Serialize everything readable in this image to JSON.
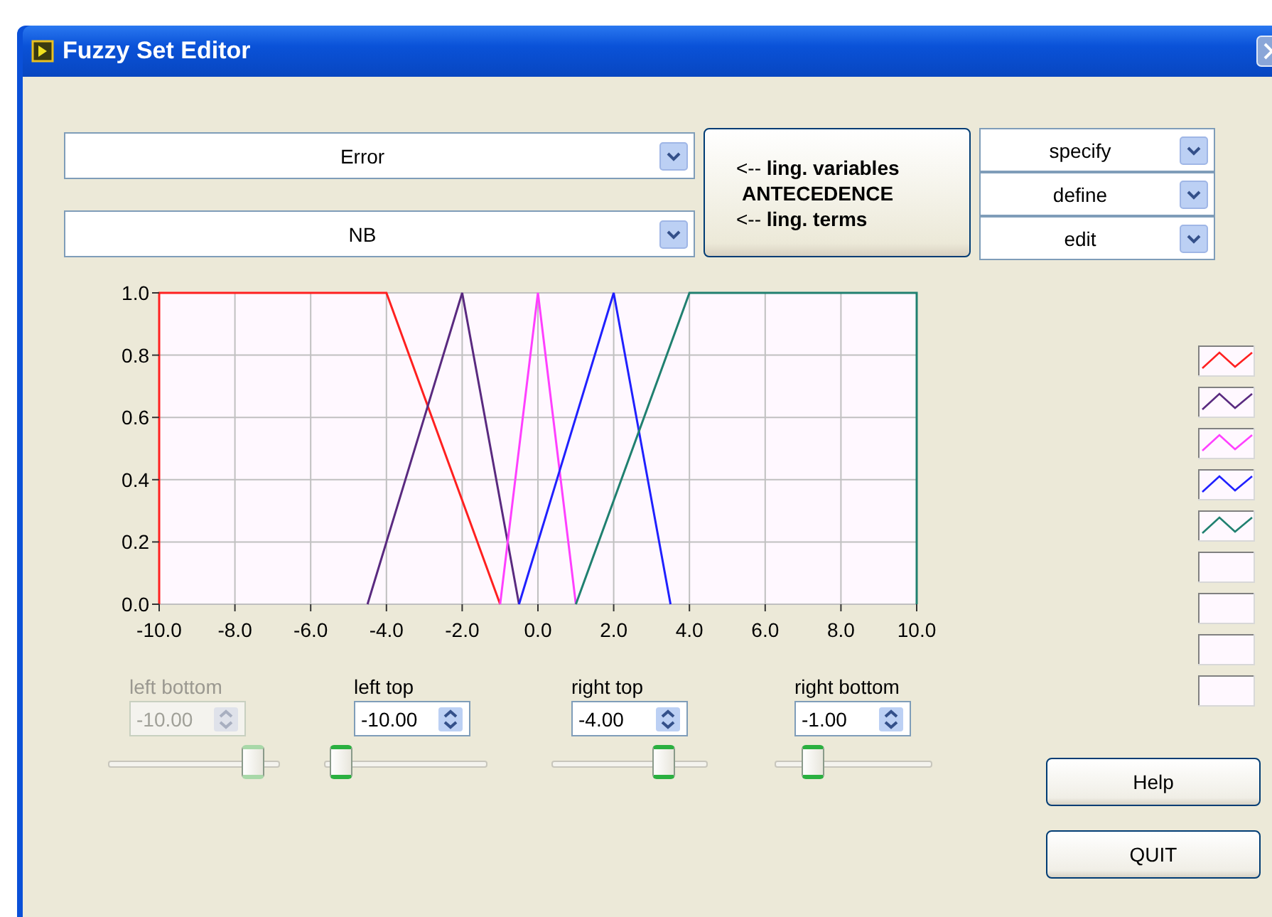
{
  "window": {
    "title": "Fuzzy Set Editor"
  },
  "selectors": [
    {
      "value": "Error"
    },
    {
      "value": "NB"
    }
  ],
  "mode_button": {
    "lines": [
      "<-- **ling. variables**",
      "**ANTECEDENCE**",
      "<-- **ling. terms**"
    ]
  },
  "actions": [
    {
      "value": "specify"
    },
    {
      "value": "define"
    },
    {
      "value": "edit"
    }
  ],
  "chart": {
    "chart_data": {
      "type": "line",
      "grid": true,
      "xlim": [
        -10,
        10
      ],
      "ylim": [
        0,
        1
      ],
      "xticks": [
        {
          "value": -10,
          "label": "-10.0"
        },
        {
          "value": -8,
          "label": "-8.0"
        },
        {
          "value": -6,
          "label": "-6.0"
        },
        {
          "value": -4,
          "label": "-4.0"
        },
        {
          "value": -2,
          "label": "-2.0"
        },
        {
          "value": 0,
          "label": "0.0"
        },
        {
          "value": 2,
          "label": "2.0"
        },
        {
          "value": 4,
          "label": "4.0"
        },
        {
          "value": 6,
          "label": "6.0"
        },
        {
          "value": 8,
          "label": "8.0"
        },
        {
          "value": 10,
          "label": "10.0"
        }
      ],
      "yticks": [
        {
          "value": 0,
          "label": "0.0"
        },
        {
          "value": 0.2,
          "label": "0.2"
        },
        {
          "value": 0.4,
          "label": "0.4"
        },
        {
          "value": 0.6,
          "label": "0.6"
        },
        {
          "value": 0.8,
          "label": "0.8"
        },
        {
          "value": 1,
          "label": "1.0"
        }
      ],
      "series": [
        {
          "color": "#ff2020",
          "x": [
            -10,
            -10,
            -4,
            -1
          ],
          "values": [
            0,
            1,
            1,
            0
          ]
        },
        {
          "color": "#5a2a80",
          "x": [
            -4.5,
            -2,
            -0.5
          ],
          "values": [
            0,
            1,
            0
          ]
        },
        {
          "color": "#ff40ff",
          "x": [
            -1,
            0,
            1
          ],
          "values": [
            0,
            1,
            0
          ]
        },
        {
          "color": "#2020ff",
          "x": [
            -0.5,
            2,
            3.5
          ],
          "values": [
            0,
            1,
            0
          ]
        },
        {
          "color": "#208070",
          "x": [
            1,
            4,
            10,
            10
          ],
          "values": [
            0,
            1,
            1,
            0
          ]
        }
      ]
    }
  },
  "controls": [
    {
      "label": "left bottom",
      "value": "-10.00",
      "disabled": true,
      "level": 0.9
    },
    {
      "label": "left top",
      "value": "-10.00",
      "disabled": false,
      "level": 0.04
    },
    {
      "label": "right top",
      "value": "-4.00",
      "disabled": false,
      "level": 0.76
    },
    {
      "label": "right bottom",
      "value": "-1.00",
      "disabled": false,
      "level": 0.2
    }
  ],
  "legend": [
    {
      "kind": "swatch",
      "color": "#ff2020"
    },
    {
      "kind": "swatch",
      "color": "#5a2a80"
    },
    {
      "kind": "swatch",
      "color": "#ff40ff"
    },
    {
      "kind": "swatch",
      "color": "#2020ff"
    },
    {
      "kind": "swatch",
      "color": "#208070"
    },
    {
      "kind": "empty"
    },
    {
      "kind": "empty"
    },
    {
      "kind": "empty"
    },
    {
      "kind": "empty"
    }
  ],
  "buttons": [
    "Help",
    "QUIT"
  ]
}
